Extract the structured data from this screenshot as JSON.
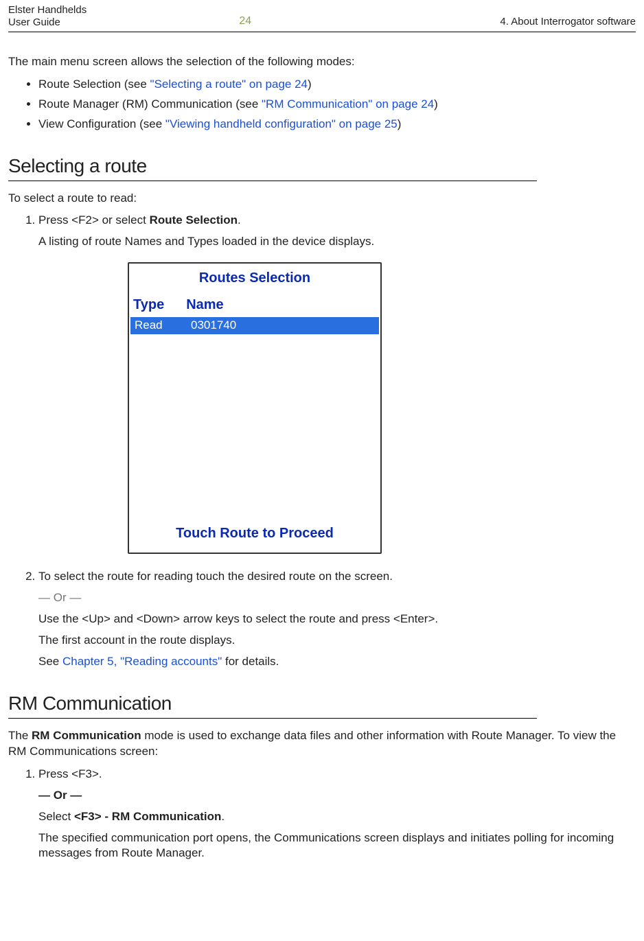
{
  "header": {
    "left_line1": "Elster Handhelds",
    "left_line2": "User Guide",
    "page_number": "24",
    "right": "4. About Interrogator software"
  },
  "intro": "The main menu screen allows the selection of the following modes:",
  "bullets": [
    {
      "prefix": "Route Selection (see ",
      "link": "\"Selecting a route\" on page 24",
      "suffix": ")"
    },
    {
      "prefix": "Route Manager (RM) Communication (see ",
      "link": "\"RM Communication\" on page 24",
      "suffix": ")"
    },
    {
      "prefix": "View Configuration (see ",
      "link": "\"Viewing handheld configuration\" on page 25",
      "suffix": ")"
    }
  ],
  "section1": {
    "title": "Selecting a route",
    "lead": "To select a route to read:",
    "step1_a": "Press <F2> or select ",
    "step1_bold": "Route Selection",
    "step1_b": ".",
    "step1_result": "A listing of route Names and Types loaded in the device displays.",
    "step2_a": "To select the route for reading touch the desired route on the screen.",
    "or": "— Or —",
    "step2_b": "Use the <Up> and <Down> arrow keys to select the route and press <Enter>.",
    "step2_c": "The first account in the route displays.",
    "step2_d_prefix": "See ",
    "step2_d_link": "Chapter 5, \"Reading accounts\"",
    "step2_d_suffix": " for details."
  },
  "screenshot": {
    "title": "Routes Selection",
    "col1": "Type",
    "col2": "Name",
    "row_type": "Read",
    "row_name": "0301740",
    "footer": "Touch Route to Proceed"
  },
  "section2": {
    "title": "RM Communication",
    "p1_a": "The ",
    "p1_bold": "RM Communication",
    "p1_b": " mode is used to exchange data files and other information with Route Manager. To view the RM Communications screen:",
    "step1": "Press <F3>.",
    "or": "— Or —",
    "step_sel_a": "Select ",
    "step_sel_bold": "<F3> - RM Communication",
    "step_sel_b": ".",
    "step_res": "The specified communication port opens, the Communications screen displays and initiates polling for incoming messages from Route Manager."
  }
}
